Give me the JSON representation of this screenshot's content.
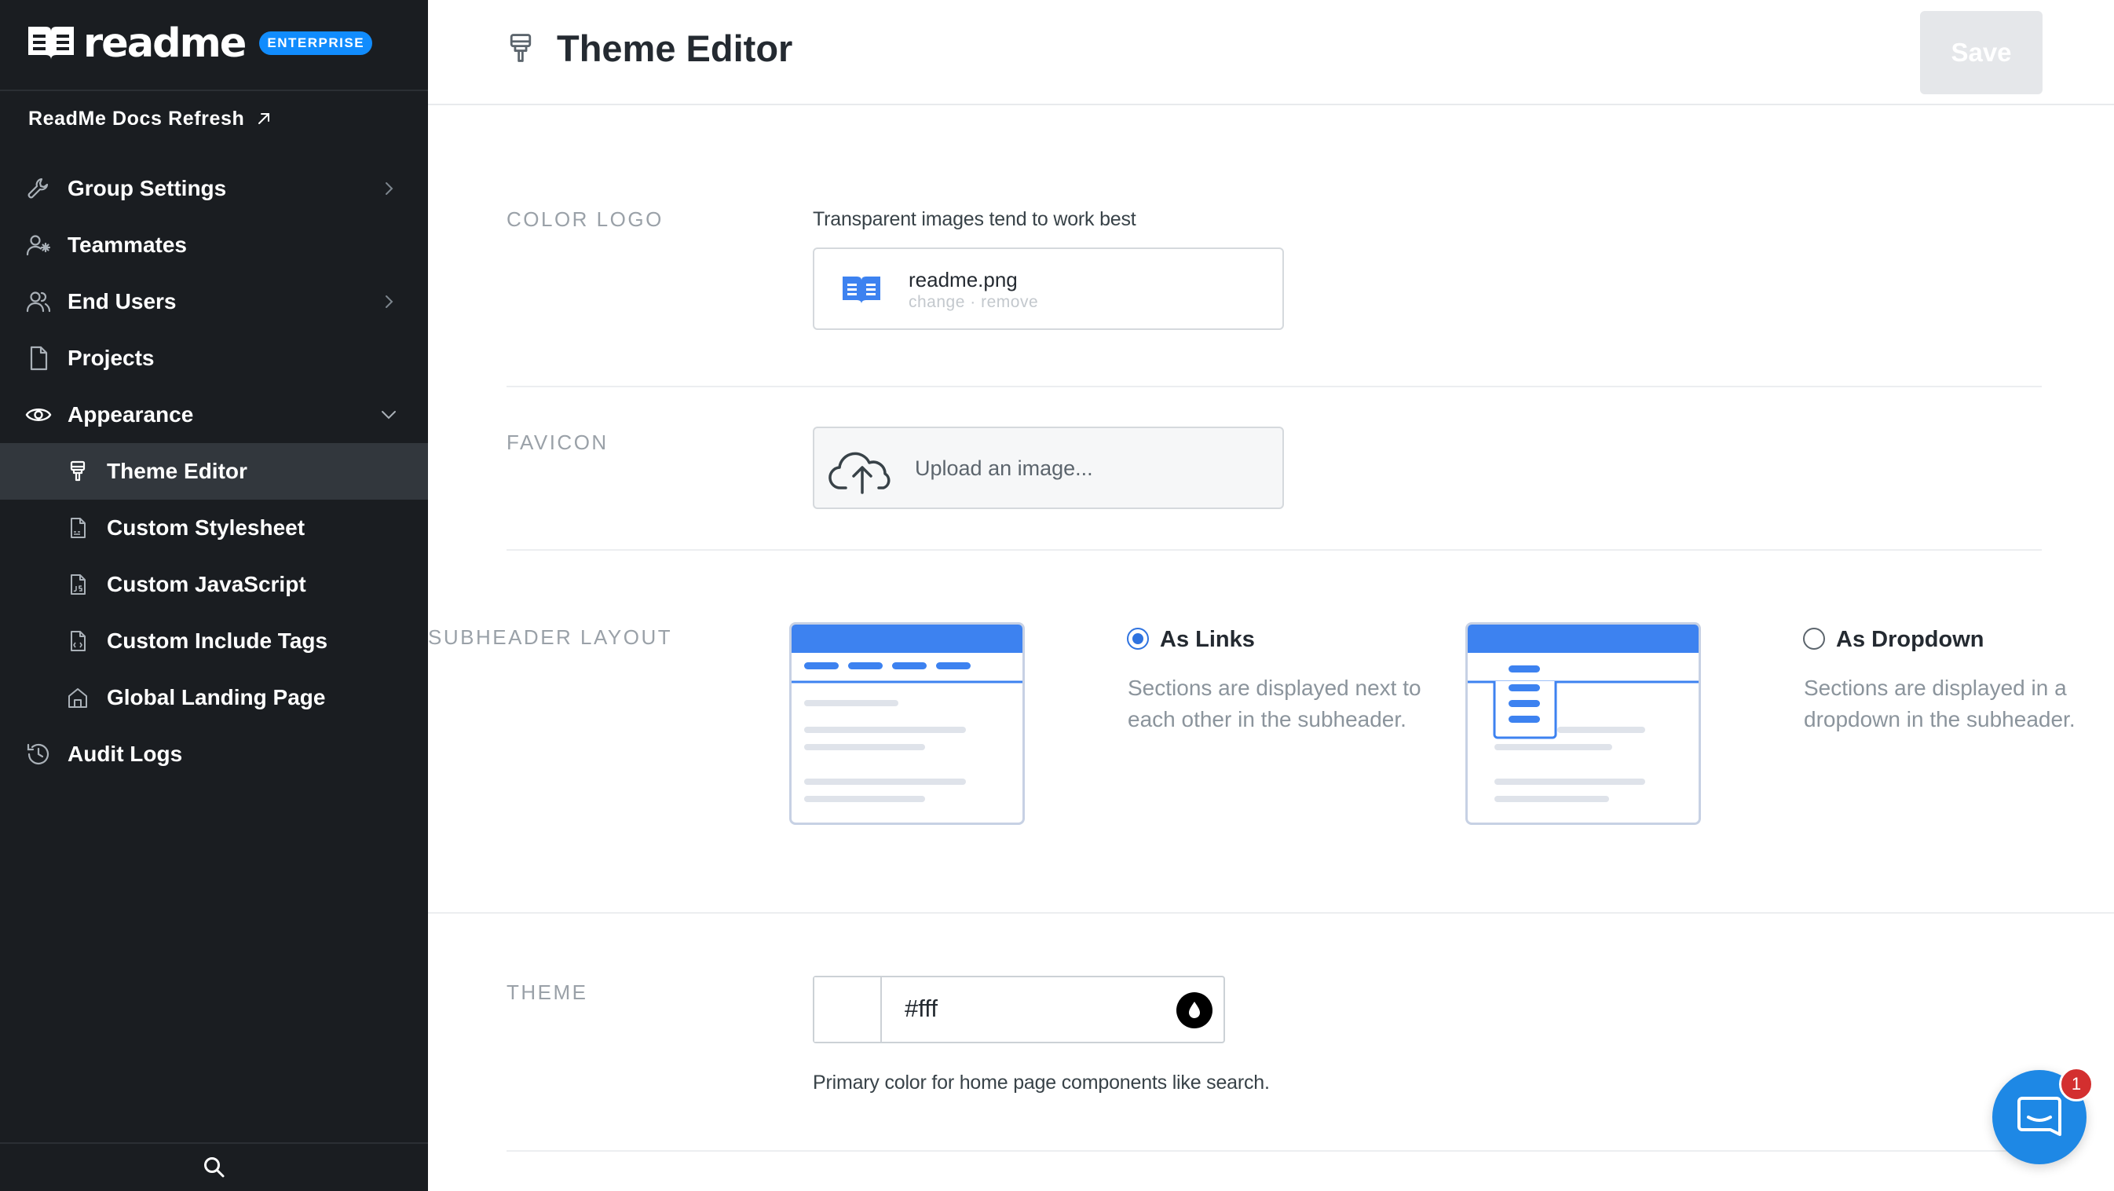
{
  "brand": {
    "name": "readme",
    "badge": "ENTERPRISE"
  },
  "sidebar": {
    "project_link": "ReadMe Docs Refresh",
    "items": [
      {
        "label": "Group Settings",
        "icon": "wrench-icon",
        "has_chevron": true
      },
      {
        "label": "Teammates",
        "icon": "user-star-icon"
      },
      {
        "label": "End Users",
        "icon": "users-icon",
        "has_chevron": true
      },
      {
        "label": "Projects",
        "icon": "file-icon"
      },
      {
        "label": "Appearance",
        "icon": "eye-icon",
        "expanded": true
      },
      {
        "label": "Theme Editor",
        "icon": "paintbrush-icon",
        "active": true
      },
      {
        "label": "Custom Stylesheet",
        "icon": "css-file-icon"
      },
      {
        "label": "Custom JavaScript",
        "icon": "js-file-icon"
      },
      {
        "label": "Custom Include Tags",
        "icon": "html-file-icon"
      },
      {
        "label": "Global Landing Page",
        "icon": "home-icon"
      },
      {
        "label": "Audit Logs",
        "icon": "history-icon"
      }
    ]
  },
  "header": {
    "title": "Theme Editor",
    "save_label": "Save"
  },
  "color_logo": {
    "label": "COLOR LOGO",
    "hint": "Transparent images tend to work best",
    "file_name": "readme.png",
    "change": "change",
    "separator": "·",
    "remove": "remove"
  },
  "favicon": {
    "label": "FAVICON",
    "upload_text": "Upload an image..."
  },
  "subheader_layout": {
    "label": "SUBHEADER LAYOUT",
    "options": [
      {
        "title": "As Links",
        "description": "Sections are displayed next to each other in the subheader.",
        "selected": true
      },
      {
        "title": "As Dropdown",
        "description": "Sections are displayed in a dropdown in the subheader.",
        "selected": false
      }
    ]
  },
  "theme": {
    "label": "THEME",
    "color_value": "#fff",
    "hint": "Primary color for home page components like search."
  },
  "chat": {
    "badge_count": "1"
  },
  "colors": {
    "sidebar_bg": "#1a1d21",
    "active_item_bg": "#32373d",
    "accent": "#118cfd",
    "thumb_blue": "#3d82f0"
  }
}
